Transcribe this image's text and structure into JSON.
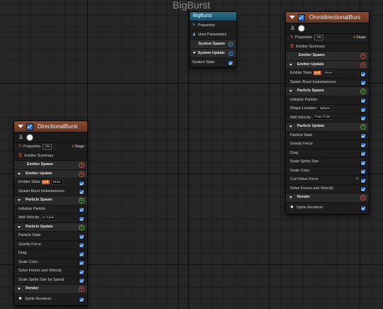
{
  "graph": {
    "title": "BigBurst"
  },
  "system_node": {
    "title": "BigBurst",
    "rows": [
      {
        "label": "Properties"
      },
      {
        "label": "User Parameters"
      },
      {
        "label": "System Spawn"
      },
      {
        "label": "System Update"
      },
      {
        "label": "System State"
      }
    ]
  },
  "directional": {
    "title": "DirectionalBurst",
    "properties_label": "Properties",
    "on_label": "ON",
    "stage_label": "Stage",
    "emitter_summary": "Emitter Summary",
    "emitter_spawn": "Emitter Spawn",
    "emitter_update": "Emitter Update",
    "emitter_state": "Emitter State",
    "self_badge": "Self",
    "once_value": "Once",
    "spawn_burst": "Spawn Burst Instantaneous",
    "particle_spawn": "Particle Spawn",
    "initialize_particle": "Initialize Particle",
    "add_velocity": "Add Velocity",
    "add_velocity_value": "In Cone",
    "particle_update": "Particle Update",
    "update_modules": [
      "Particle State",
      "Gravity Force",
      "Drag",
      "Scale Color",
      "Solve Forces and Velocity",
      "Scale Sprite Size by Speed"
    ],
    "render": "Render",
    "sprite_renderer": "Sprite Renderer"
  },
  "omni": {
    "title": "OmnidirectionalBurs",
    "properties_label": "Properties",
    "on_label": "ON",
    "stage_label": "Stage",
    "emitter_summary": "Emitter Summary",
    "emitter_spawn": "Emitter Spawn",
    "emitter_update": "Emitter Update",
    "emitter_state": "Emitter State",
    "self_badge": "Self",
    "once_value": "Once",
    "spawn_burst": "Spawn Burst Instantaneous",
    "particle_spawn": "Particle Spawn",
    "initialize_particle": "Initialize Particle",
    "shape_location": "Shape Location",
    "shape_location_value": "Sphere",
    "add_velocity": "Add Velocity",
    "add_velocity_value": "From Point",
    "particle_update": "Particle Update",
    "update_modules": [
      "Particle State",
      "Gravity Force",
      "Drag",
      "Scale Sprite Size",
      "Scale Color",
      "Curl Noise Force",
      "Solve Forces and Velocity"
    ],
    "render": "Render",
    "sprite_renderer": "Sprite Renderer"
  }
}
